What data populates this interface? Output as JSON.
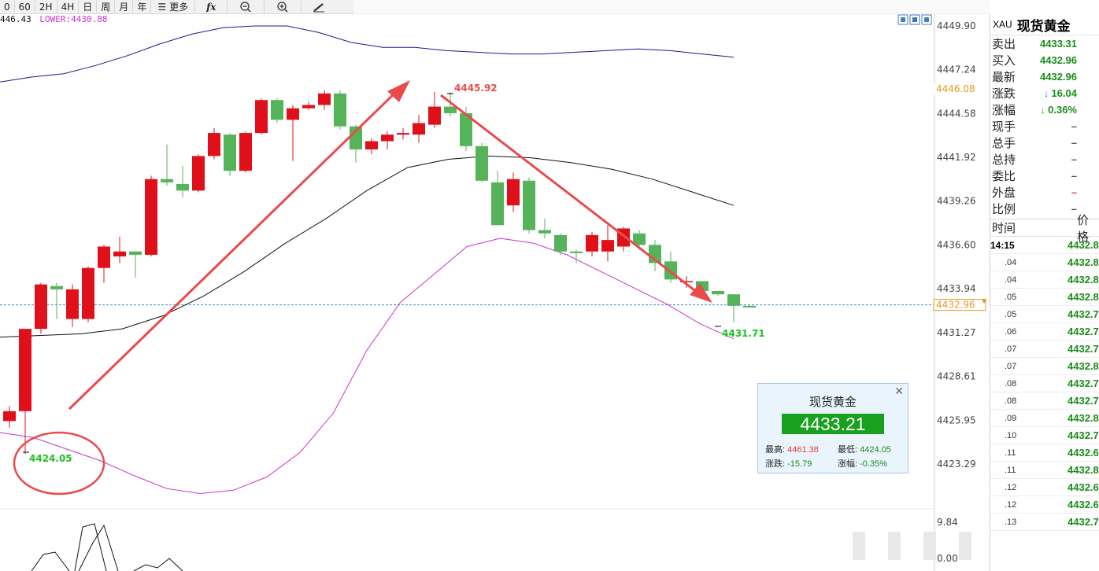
{
  "toolbar": {
    "items": [
      "0",
      "60",
      "2H",
      "4H",
      "日",
      "周",
      "月",
      "年",
      "更多",
      "fx",
      "zoom-out-icon",
      "zoom-in-icon",
      "draw-icon"
    ],
    "more_label": "更多"
  },
  "bollinger": {
    "mid_prefix": "446.43",
    "lower_label": "LOWER:4430.88"
  },
  "chart_data": {
    "type": "candlestick",
    "y_ticks": [
      "4449.90",
      "4447.24",
      "4444.58",
      "4441.92",
      "4439.26",
      "4436.60",
      "4433.94",
      "4431.27",
      "4428.61",
      "4425.95",
      "4423.29"
    ],
    "current_price_label": "4432.96",
    "marker_price_label": "4446.08",
    "high_annotation": "4445.92",
    "low_annotation_right": "4431.71",
    "low_annotation_left": "4424.05",
    "candles": [
      [
        4425.9,
        4426.5,
        4426.8,
        4425.5
      ],
      [
        4426.5,
        4431.5,
        4427.0,
        4423.9
      ],
      [
        4431.5,
        4434.2,
        4434.3,
        4431.2
      ],
      [
        4434.1,
        4433.9,
        4434.3,
        4432.1
      ],
      [
        4432.1,
        4433.9,
        4434.2,
        4431.6
      ],
      [
        4432.1,
        4435.2,
        4435.3,
        4431.9
      ],
      [
        4435.2,
        4436.5,
        4436.6,
        4434.3
      ],
      [
        4435.9,
        4436.2,
        4437.1,
        4435.5
      ],
      [
        4436.2,
        4436.0,
        4436.2,
        4434.6
      ],
      [
        4436.0,
        4440.6,
        4440.8,
        4435.9
      ],
      [
        4440.6,
        4440.4,
        4442.7,
        4440.2
      ],
      [
        4440.3,
        4439.9,
        4441.4,
        4439.5
      ],
      [
        4439.9,
        4442.0,
        4442.1,
        4439.8
      ],
      [
        4442.0,
        4443.4,
        4443.7,
        4441.8
      ],
      [
        4443.3,
        4441.1,
        4443.4,
        4440.8
      ],
      [
        4441.1,
        4443.4,
        4443.5,
        4441.0
      ],
      [
        4443.4,
        4445.4,
        4445.5,
        4443.3
      ],
      [
        4445.4,
        4444.2,
        4445.5,
        4444.0
      ],
      [
        4444.2,
        4444.9,
        4445.1,
        4441.7
      ],
      [
        4444.9,
        4445.1,
        4445.3,
        4444.8
      ],
      [
        4445.1,
        4445.8,
        4446.0,
        4444.8
      ],
      [
        4445.8,
        4443.8,
        4446.0,
        4443.6
      ],
      [
        4443.8,
        4442.4,
        4443.9,
        4441.6
      ],
      [
        4442.4,
        4442.9,
        4443.1,
        4442.1
      ],
      [
        4442.9,
        4443.3,
        4443.5,
        4442.4
      ],
      [
        4443.3,
        4443.4,
        4443.7,
        4443.0
      ],
      [
        4443.3,
        4444.0,
        4444.5,
        4442.8
      ],
      [
        4443.9,
        4445.0,
        4445.9,
        4443.7
      ],
      [
        4445.0,
        4444.6,
        4445.9,
        4444.4
      ],
      [
        4444.6,
        4442.6,
        4445.0,
        4442.3
      ],
      [
        4442.6,
        4440.5,
        4442.8,
        4440.4
      ],
      [
        4440.4,
        4437.8,
        4441.1,
        4437.8
      ],
      [
        4439.0,
        4440.6,
        4441.0,
        4438.6
      ],
      [
        4440.5,
        4437.5,
        4440.7,
        4437.3
      ],
      [
        4437.5,
        4437.3,
        4438.2,
        4437.0
      ],
      [
        4437.2,
        4436.2,
        4437.3,
        4436.0
      ],
      [
        4436.2,
        4436.1,
        4436.3,
        4435.5
      ],
      [
        4436.2,
        4437.2,
        4437.4,
        4435.9
      ],
      [
        4436.2,
        4436.9,
        4437.8,
        4435.6
      ],
      [
        4436.5,
        4437.6,
        4437.7,
        4436.2
      ],
      [
        4437.3,
        4436.6,
        4437.5,
        4436.3
      ],
      [
        4436.6,
        4435.5,
        4436.9,
        4435.0
      ],
      [
        4435.6,
        4434.5,
        4436.2,
        4434.3
      ],
      [
        4434.4,
        4434.4,
        4434.7,
        4434.0
      ],
      [
        4434.4,
        4433.8,
        4434.4,
        4433.6
      ],
      [
        4433.8,
        4433.6,
        4433.8,
        4433.5
      ],
      [
        4433.6,
        4432.9,
        4433.6,
        4431.9
      ],
      [
        4432.9,
        4432.8,
        4433.0,
        4432.8
      ]
    ],
    "candle_spacing_data": 1
  },
  "panel": {
    "code": "XAU",
    "name": "现货黄金",
    "quotes": [
      {
        "label": "卖出",
        "value": "4433.31",
        "color": "#1a8c1a"
      },
      {
        "label": "买入",
        "value": "4432.96",
        "color": "#1a8c1a"
      },
      {
        "label": "最新",
        "value": "4432.96",
        "color": "#1a8c1a"
      },
      {
        "label": "涨跌",
        "value": "16.04",
        "color": "#1a8c1a"
      },
      {
        "label": "涨幅",
        "value": "0.36%",
        "color": "#1a8c1a"
      },
      {
        "label": "现手",
        "value": "–",
        "color": "#555"
      },
      {
        "label": "总手",
        "value": "–",
        "color": "#555"
      },
      {
        "label": "总持",
        "value": "–",
        "color": "#555"
      },
      {
        "label": "委比",
        "value": "–",
        "color": "#555"
      },
      {
        "label": "外盘",
        "value": "–",
        "color": "#e23b3b"
      },
      {
        "label": "比例",
        "value": "–",
        "color": "#555"
      }
    ],
    "ticks_header": {
      "time": "时间",
      "price": "价格"
    },
    "ticks": [
      {
        "time": "14:15",
        "price": "4432.8"
      },
      {
        "time": ".04",
        "price": "4432.8"
      },
      {
        "time": ".04",
        "price": "4432.8"
      },
      {
        "time": ".05",
        "price": "4432.8"
      },
      {
        "time": ".05",
        "price": "4432.7"
      },
      {
        "time": ".06",
        "price": "4432.7"
      },
      {
        "time": ".07",
        "price": "4432.7"
      },
      {
        "time": ".07",
        "price": "4432.8"
      },
      {
        "time": ".08",
        "price": "4432.7"
      },
      {
        "time": ".08",
        "price": "4432.7"
      },
      {
        "time": ".09",
        "price": "4432.8"
      },
      {
        "time": ".10",
        "price": "4432.7"
      },
      {
        "time": ".11",
        "price": "4432.6"
      },
      {
        "time": ".11",
        "price": "4432.8"
      },
      {
        "time": ".12",
        "price": "4432.6"
      },
      {
        "time": ".12",
        "price": "4432.6"
      },
      {
        "time": ".13",
        "price": "4432.7"
      }
    ]
  },
  "popup": {
    "title": "现货黄金",
    "price": "4433.21",
    "high_label": "最高:",
    "high": "4461.38",
    "low_label": "最低:",
    "low": "4424.05",
    "change_label": "涨跌:",
    "change": "-15.79",
    "pct_label": "涨幅:",
    "pct": "-0.35%"
  },
  "sub_chart": {
    "value_label": "9.84",
    "bottom_label": "0.00"
  },
  "colors": {
    "up": "#e0101a",
    "down": "#55b35a",
    "annotation_red": "#e94b4b",
    "annotation_green": "#22c022",
    "boll_lower": "#cc33cc",
    "boll_upper": "#1a1a8a",
    "boll_mid": "#111111",
    "accent_orange": "#e59a20"
  }
}
